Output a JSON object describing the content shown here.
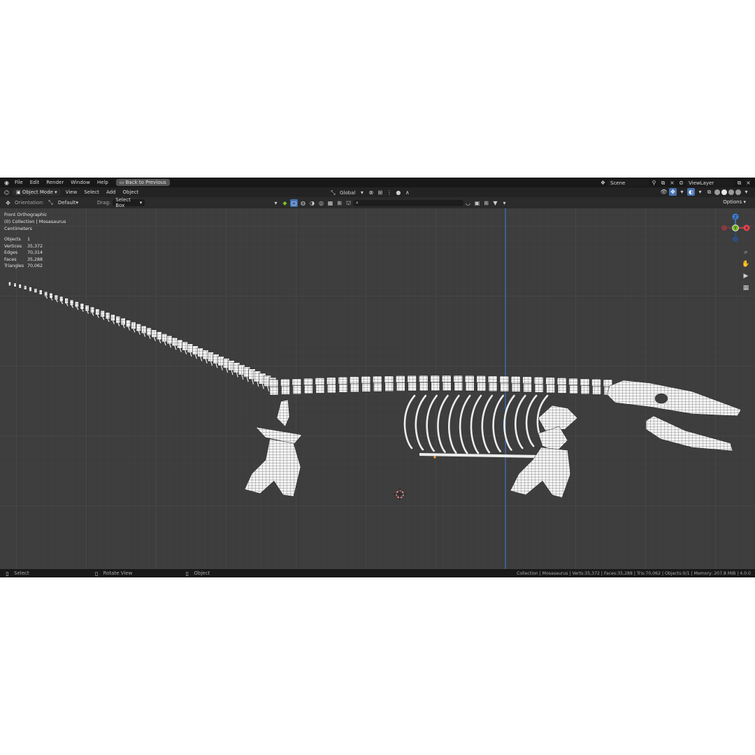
{
  "topbar": {
    "menus": [
      "File",
      "Edit",
      "Render",
      "Window",
      "Help"
    ],
    "back_button": "Back to Previous",
    "scene_name": "Scene",
    "view_layer": "ViewLayer"
  },
  "header": {
    "mode": "Object Mode",
    "menus": [
      "View",
      "Select",
      "Add",
      "Object"
    ],
    "transform_orientation": "Global"
  },
  "toolbar": {
    "orientation_label": "Orientation:",
    "orientation_value": "Default",
    "drag_label": "Drag:",
    "drag_value": "Select Box",
    "search_placeholder": "",
    "options_label": "Options"
  },
  "viewport": {
    "view_name": "Front Orthographic",
    "collection_path": "(0) Collection | Mosasaurus",
    "units": "Centimeters",
    "stats": [
      {
        "label": "Objects",
        "value": "1"
      },
      {
        "label": "Vertices",
        "value": "35,372"
      },
      {
        "label": "Edges",
        "value": "70,314"
      },
      {
        "label": "Faces",
        "value": "35,288"
      },
      {
        "label": "Triangles",
        "value": "70,062"
      }
    ],
    "gizmo_axes": {
      "z": "Z",
      "y": "Y",
      "x": "X"
    }
  },
  "statusbar": {
    "left_click": "Select",
    "middle_click": "Rotate View",
    "right_click": "Object",
    "info": "Collection | Mosasaurus | Verts:35,372 | Faces:35,288 | Tris:70,062 | Objects:0/1 | Memory: 207.8 MiB | 4.0.0"
  },
  "colors": {
    "accent": "#4772b3",
    "axis_x": "#e0444d",
    "axis_y": "#7cbf2b",
    "axis_z": "#3d7fd6",
    "viewport_bg": "#3d3d3d"
  }
}
